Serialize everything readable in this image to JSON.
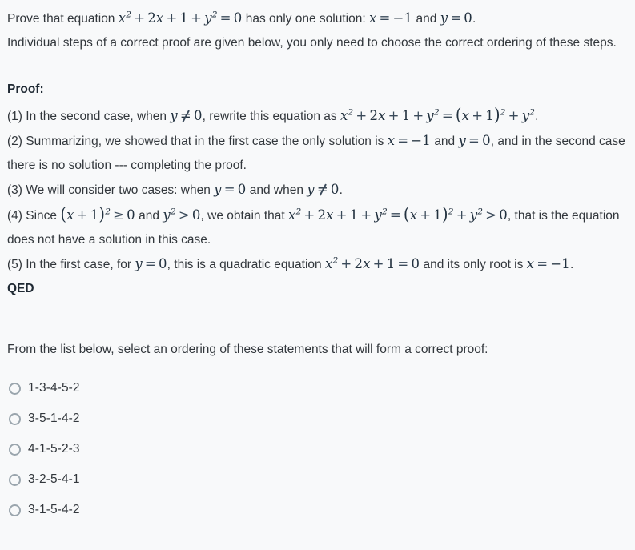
{
  "problem": {
    "statement_pre": "Prove that equation",
    "statement_equation": "x² + 2x + 1 + y² = 0",
    "statement_mid": "has only one solution:",
    "statement_sol_x": "x = −1",
    "statement_and": "and",
    "statement_sol_y": "y = 0",
    "statement_period": ".",
    "instructions": "Individual steps of a correct proof are given below, you only need to choose the correct ordering of these steps."
  },
  "proof": {
    "heading": "Proof:",
    "qed": "QED",
    "steps": [
      {
        "number": "(1)",
        "text_a": "In the second case, when",
        "math_a": "y ≠ 0",
        "text_b": ", rewrite this equation as",
        "math_b": "x² + 2x + 1 + y² = (x + 1)² + y²",
        "text_c": "."
      },
      {
        "number": "(2)",
        "text_a": "Summarizing, we showed that in the first case the only solution is",
        "math_a": "x = −1",
        "text_b": "and",
        "math_b": "y = 0",
        "text_c": ", and in the second case there is no solution --- completing the proof."
      },
      {
        "number": "(3)",
        "text_a": "We will consider two cases: when",
        "math_a": "y = 0",
        "text_b": "and when",
        "math_b": "y ≠ 0",
        "text_c": "."
      },
      {
        "number": "(4)",
        "text_a": "Since",
        "math_a": "(x + 1)² ≥ 0",
        "text_b": "and",
        "math_b": "y² > 0",
        "text_c": ", we obtain that",
        "math_c": "x² + 2x + 1 + y² = (x + 1)² + y² > 0",
        "text_d": ", that is the equation does not have a solution in this case."
      },
      {
        "number": "(5)",
        "text_a": "In the first case, for",
        "math_a": "y = 0",
        "text_b": ", this is a quadratic equation",
        "math_b": "x² + 2x + 1 = 0",
        "text_c": "and its only root is",
        "math_c": "x = −1",
        "text_d": "."
      }
    ]
  },
  "question": {
    "prompt": "From the list below, select an ordering of these statements that will form a correct proof:",
    "options": [
      {
        "label": "1-3-4-5-2",
        "selected": false
      },
      {
        "label": "3-5-1-4-2",
        "selected": false
      },
      {
        "label": "4-1-5-2-3",
        "selected": false
      },
      {
        "label": "3-2-5-4-1",
        "selected": false
      },
      {
        "label": "3-1-5-4-2",
        "selected": false
      }
    ]
  },
  "colors": {
    "background": "#f8f9fa",
    "text": "#32373c",
    "math": "#22313f",
    "radio_border": "#9aa5ad"
  }
}
